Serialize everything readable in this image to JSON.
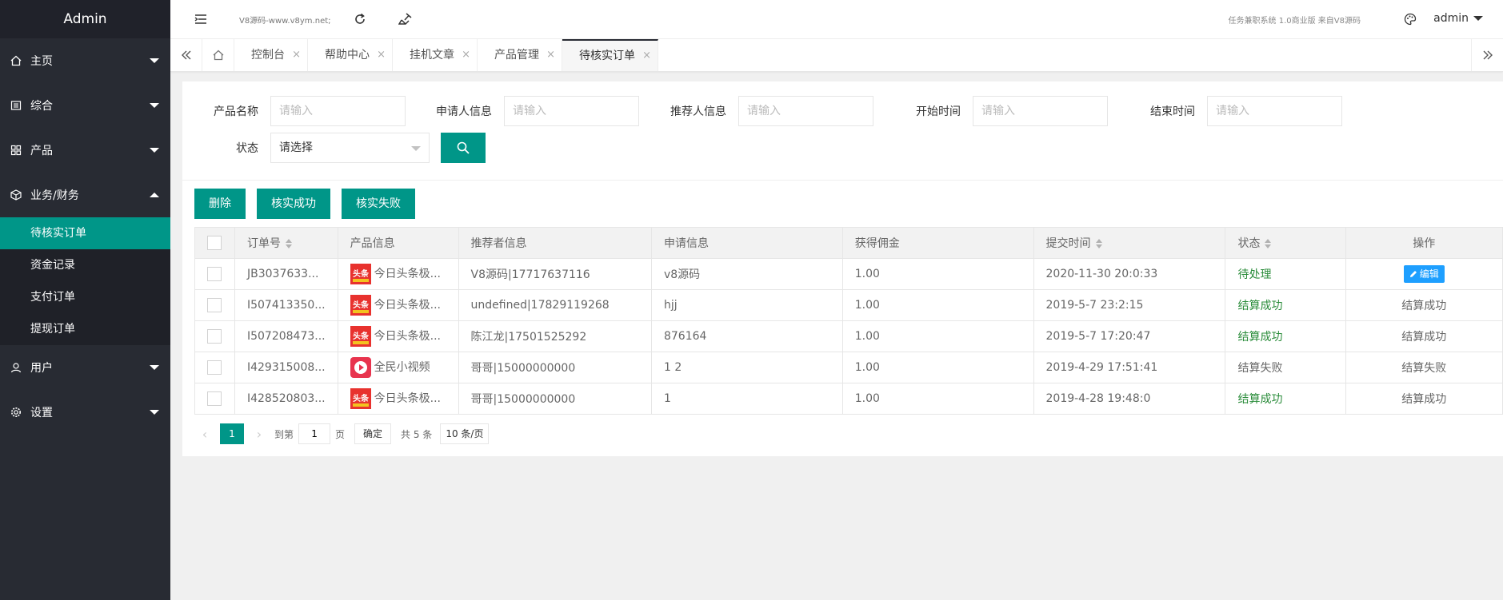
{
  "sidebar": {
    "logo": "Admin",
    "items": [
      {
        "label": "主页",
        "icon": "home-icon"
      },
      {
        "label": "综合",
        "icon": "list-icon"
      },
      {
        "label": "产品",
        "icon": "apps-icon"
      },
      {
        "label": "业务/财务",
        "icon": "cube-icon"
      }
    ],
    "sub_items": [
      "待核实订单",
      "资金记录",
      "支付订单",
      "提现订单"
    ],
    "items_after": [
      {
        "label": "用户",
        "icon": "user-icon"
      },
      {
        "label": "设置",
        "icon": "gear-icon"
      }
    ]
  },
  "header": {
    "site_text": "V8源码-www.v8ym.net;",
    "right_text": "任务兼职系统 1.0商业版 来自V8源码",
    "user": "admin"
  },
  "tabs": [
    {
      "label": "控制台"
    },
    {
      "label": "帮助中心"
    },
    {
      "label": "挂机文章"
    },
    {
      "label": "产品管理"
    },
    {
      "label": "待核实订单"
    }
  ],
  "tab_close": "×",
  "filters": {
    "product_name_label": "产品名称",
    "applicant_label": "申请人信息",
    "referrer_label": "推荐人信息",
    "start_label": "开始时间",
    "end_label": "结束时间",
    "placeholder": "请输入",
    "status_label": "状态",
    "status_value": "请选择"
  },
  "actions": {
    "delete": "删除",
    "verify_ok": "核实成功",
    "verify_fail": "核实失败"
  },
  "table": {
    "headers": [
      "订单号",
      "产品信息",
      "推荐者信息",
      "申请信息",
      "获得佣金",
      "提交时间",
      "状态",
      "操作"
    ],
    "rows": [
      {
        "order": "JB3037633...",
        "product": "今日头条极...",
        "pico": "toutiao",
        "referrer": "V8源码|17717637116",
        "apply": "v8源码",
        "commission": "1.00",
        "time": "2020-11-30 20:0:33",
        "status": "待处理",
        "op": "编辑"
      },
      {
        "order": "I507413350...",
        "product": "今日头条极...",
        "pico": "toutiao",
        "referrer": "undefined|17829119268",
        "apply": "hjj",
        "commission": "1.00",
        "time": "2019-5-7 23:2:15",
        "status": "结算成功",
        "op": "结算成功"
      },
      {
        "order": "I507208473...",
        "product": "今日头条极...",
        "pico": "toutiao",
        "referrer": "陈江龙|17501525292",
        "apply": "876164",
        "commission": "1.00",
        "time": "2019-5-7 17:20:47",
        "status": "结算成功",
        "op": "结算成功"
      },
      {
        "order": "I429315008...",
        "product": "全民小视频",
        "pico": "quanmin",
        "referrer": "哥哥|15000000000",
        "apply": "1 2",
        "commission": "1.00",
        "time": "2019-4-29 17:51:41",
        "status": "结算失败",
        "op": "结算失败"
      },
      {
        "order": "I428520803...",
        "product": "今日头条极...",
        "pico": "toutiao",
        "referrer": "哥哥|15000000000",
        "apply": "1",
        "commission": "1.00",
        "time": "2019-4-28 19:48:0",
        "status": "结算成功",
        "op": "结算成功"
      }
    ]
  },
  "pager": {
    "current": "1",
    "goto": "到第",
    "page_input": "1",
    "page_unit": "页",
    "confirm": "确定",
    "total": "共 5 条",
    "size": "10 条/页"
  },
  "icon_text": {
    "toutiao": "头条"
  },
  "colors": {
    "sidebar_bg": "#282b33",
    "accent": "#009688",
    "edit_blue": "#1e9fff",
    "success_green": "#2a8c3a"
  }
}
